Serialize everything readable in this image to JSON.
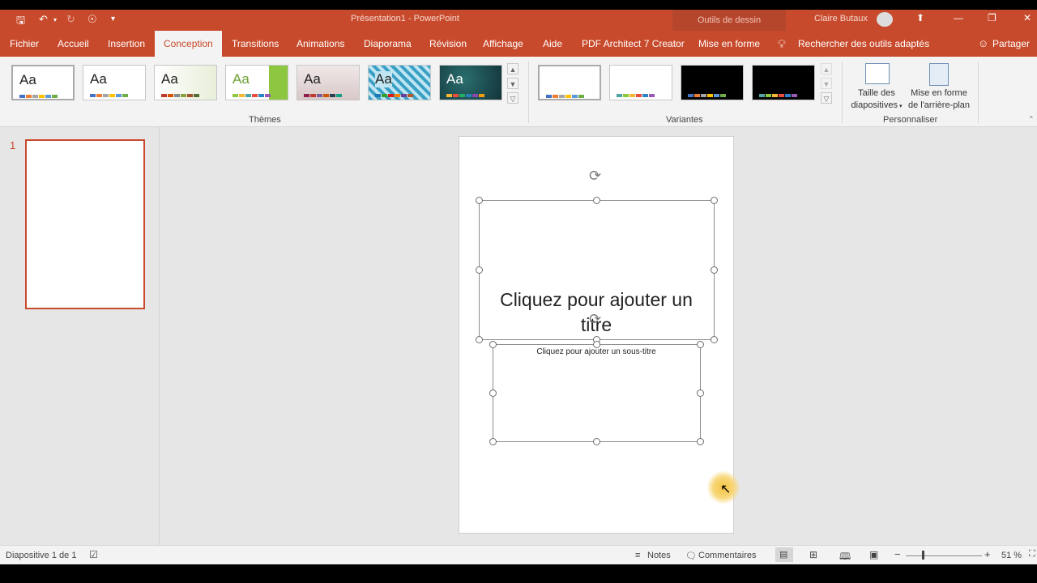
{
  "window": {
    "title": "Présentation1 - PowerPoint",
    "contextual_tab": "Outils de dessin",
    "user": "Claire Butaux"
  },
  "tabs": [
    {
      "label": "Fichier"
    },
    {
      "label": "Accueil"
    },
    {
      "label": "Insertion"
    },
    {
      "label": "Conception",
      "active": true
    },
    {
      "label": "Transitions"
    },
    {
      "label": "Animations"
    },
    {
      "label": "Diaporama"
    },
    {
      "label": "Révision"
    },
    {
      "label": "Affichage"
    },
    {
      "label": "Aide"
    },
    {
      "label": "PDF Architect 7 Creator"
    },
    {
      "label": "Mise en forme"
    }
  ],
  "tell_me": "Rechercher des outils adaptés",
  "share": "Partager",
  "ribbon": {
    "themes_label": "Thèmes",
    "variants_label": "Variantes",
    "customize_label": "Personnaliser",
    "themes_aa": [
      "Aa",
      "Aa",
      "Aa",
      "Aa",
      "Aa",
      "Aa",
      "Aa"
    ],
    "slide_size_line1": "Taille des",
    "slide_size_line2": "diapositives",
    "format_bg_line1": "Mise en forme",
    "format_bg_line2": "de l'arrière-plan"
  },
  "slide": {
    "number": "1",
    "title_placeholder_line1": "Cliquez pour ajouter un",
    "title_placeholder_line2": "titre",
    "subtitle_placeholder": "Cliquez pour ajouter un sous-titre"
  },
  "status": {
    "slide_counter": "Diapositive 1 de 1",
    "notes": "Notes",
    "comments": "Commentaires",
    "zoom": "51 %"
  },
  "colors": {
    "accent": "#c84a2c",
    "ribbon_bg": "#f3f3f3",
    "canvas_bg": "#e6e6e6"
  }
}
